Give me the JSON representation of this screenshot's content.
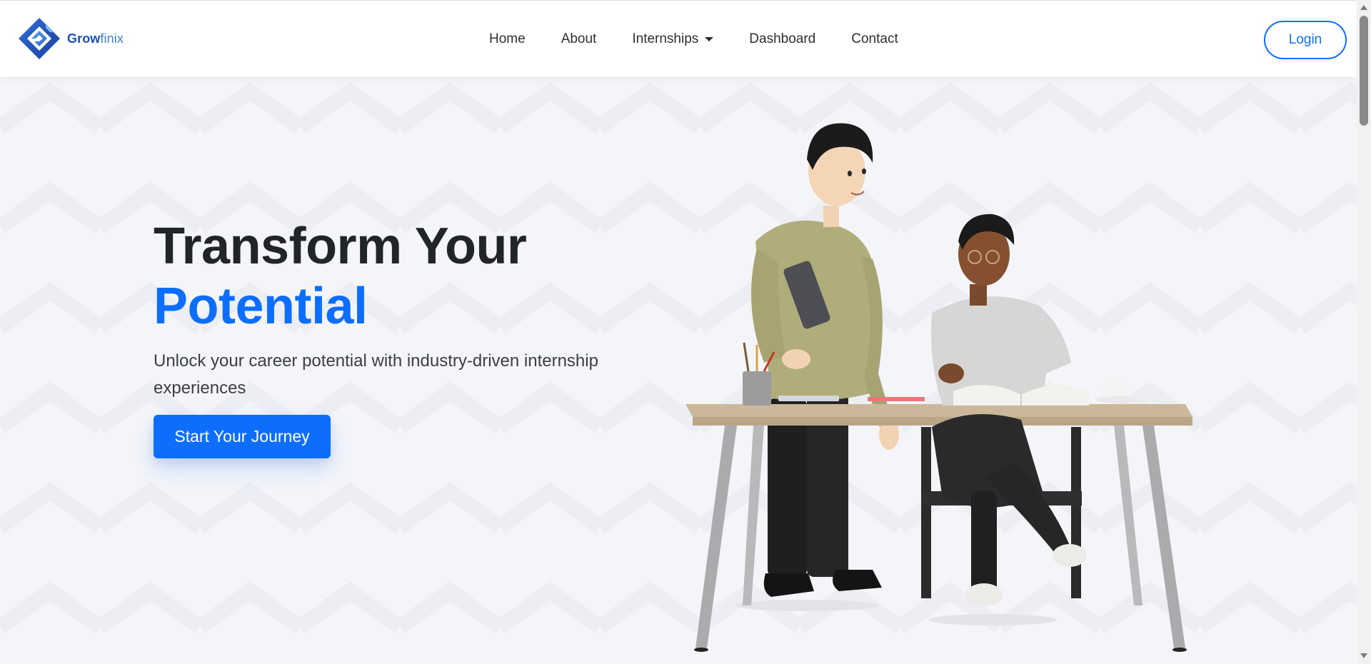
{
  "brand": {
    "name_bold": "Grow",
    "name_light": "finix"
  },
  "nav": {
    "home": "Home",
    "about": "About",
    "internships": "Internships",
    "dashboard": "Dashboard",
    "contact": "Contact"
  },
  "login_label": "Login",
  "hero": {
    "title_line1": "Transform Your",
    "title_line2": "Potential",
    "subtitle": "Unlock your career potential with industry-driven internship experiences",
    "cta_label": "Start Your Journey"
  },
  "colors": {
    "accent": "#0d6efd",
    "heading": "#212529",
    "background": "#f4f5f9",
    "brand": "#1d4fb5"
  },
  "icons": [
    "growfinix-logo-icon",
    "caret-down-icon",
    "scroll-up-icon",
    "scroll-down-icon"
  ]
}
